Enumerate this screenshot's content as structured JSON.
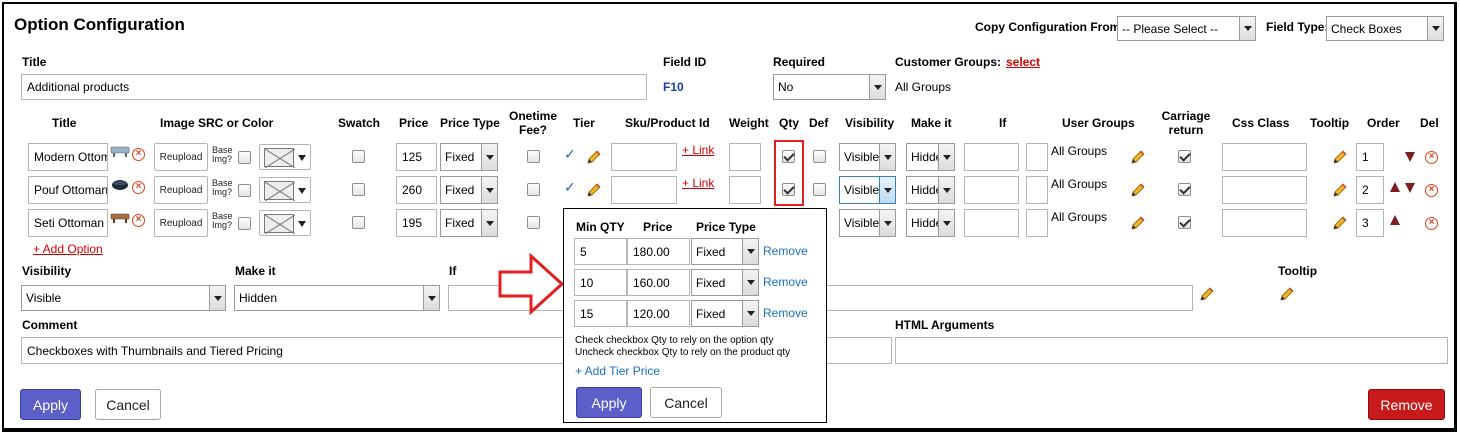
{
  "header": {
    "title": "Option Configuration",
    "copy_label": "Copy Configuration From:",
    "copy_value": "-- Please Select --",
    "field_type_label": "Field Type:",
    "field_type_value": "Check Boxes"
  },
  "fields": {
    "title_label": "Title",
    "title_value": "Additional products",
    "field_id_label": "Field ID",
    "field_id_value": "F10",
    "required_label": "Required",
    "required_value": "No",
    "customer_groups_label": "Customer Groups:",
    "customer_groups_link": "select",
    "customer_groups_value": "All Groups"
  },
  "columns": [
    "Title",
    "Image SRC or Color",
    "Swatch",
    "Price",
    "Price Type",
    "Onetime Fee?",
    "Tier",
    "Sku/Product Id",
    "Weight",
    "Qty",
    "Def",
    "Visibility",
    "Make it",
    "If",
    "User Groups",
    "Carriage return",
    "Css Class",
    "Tooltip",
    "Order",
    "Del"
  ],
  "options": [
    {
      "title": "Modern Ottoman",
      "reupload": "Reupload",
      "base_img": "Base Img?",
      "price": "125",
      "price_type": "Fixed",
      "link": "+ Link",
      "visibility": "Visible",
      "make_it": "Hidden",
      "user_groups": "All Groups",
      "order": "1",
      "qty_checked": true,
      "tier": true
    },
    {
      "title": "Pouf Ottoman",
      "reupload": "Reupload",
      "base_img": "Base Img?",
      "price": "260",
      "price_type": "Fixed",
      "link": "+ Link",
      "visibility": "Visible",
      "make_it": "Hidden",
      "user_groups": "All Groups",
      "order": "2",
      "qty_checked": true,
      "tier": true
    },
    {
      "title": "Seti Ottoman",
      "reupload": "Reupload",
      "base_img": "Base Img?",
      "price": "195",
      "price_type": "Fixed",
      "link": "",
      "visibility": "Visible",
      "make_it": "Hidden",
      "user_groups": "All Groups",
      "order": "3",
      "qty_checked": false,
      "tier": false
    }
  ],
  "add_option": "+ Add Option",
  "lower": {
    "visibility_label": "Visibility",
    "visibility_value": "Visible",
    "make_it_label": "Make it",
    "make_it_value": "Hidden",
    "if_label": "If",
    "tooltip_label": "Tooltip",
    "comment_label": "Comment",
    "comment_value": "Checkboxes with Thumbnails and Tiered Pricing",
    "html_args_label": "HTML Arguments"
  },
  "tier_popup": {
    "headers": [
      "Min QTY",
      "Price",
      "Price Type"
    ],
    "rows": [
      {
        "min_qty": "5",
        "price": "180.00",
        "type": "Fixed",
        "remove": "Remove"
      },
      {
        "min_qty": "10",
        "price": "160.00",
        "type": "Fixed",
        "remove": "Remove"
      },
      {
        "min_qty": "15",
        "price": "120.00",
        "type": "Fixed",
        "remove": "Remove"
      }
    ],
    "note1": "Check checkbox Qty to rely on the option qty",
    "note2": "Uncheck checkbox Qty to rely on the product qty",
    "add_tier": "+ Add Tier Price",
    "apply": "Apply",
    "cancel": "Cancel"
  },
  "footer": {
    "apply": "Apply",
    "cancel": "Cancel",
    "remove": "Remove"
  },
  "colors": {
    "apply": "#5b5fc7",
    "remove": "#c81a1a",
    "link_red": "#d40000",
    "highlight": "#e02020",
    "field_id": "#1a40a8"
  }
}
